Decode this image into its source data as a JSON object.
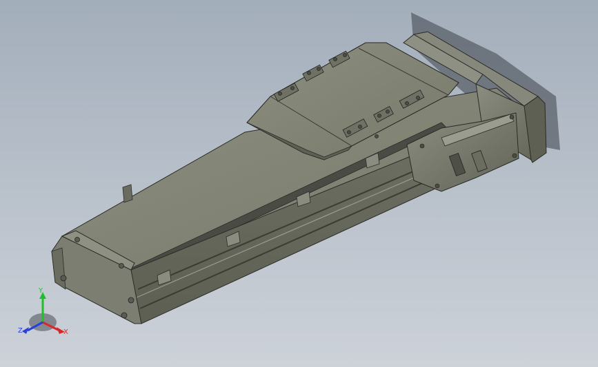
{
  "viewport": {
    "background_top": "#a3aebb",
    "background_bottom": "#cdd2d9"
  },
  "model": {
    "body_color": "#7f8174",
    "carriage_color": "#8a8c7f",
    "edge_color": "#2a2a26"
  },
  "triad": {
    "y_label": "Y",
    "x_label": "X",
    "z_label": "Z",
    "y_color": "#1fbf2a",
    "x_color": "#d8262a",
    "z_color": "#2a3ed8"
  }
}
